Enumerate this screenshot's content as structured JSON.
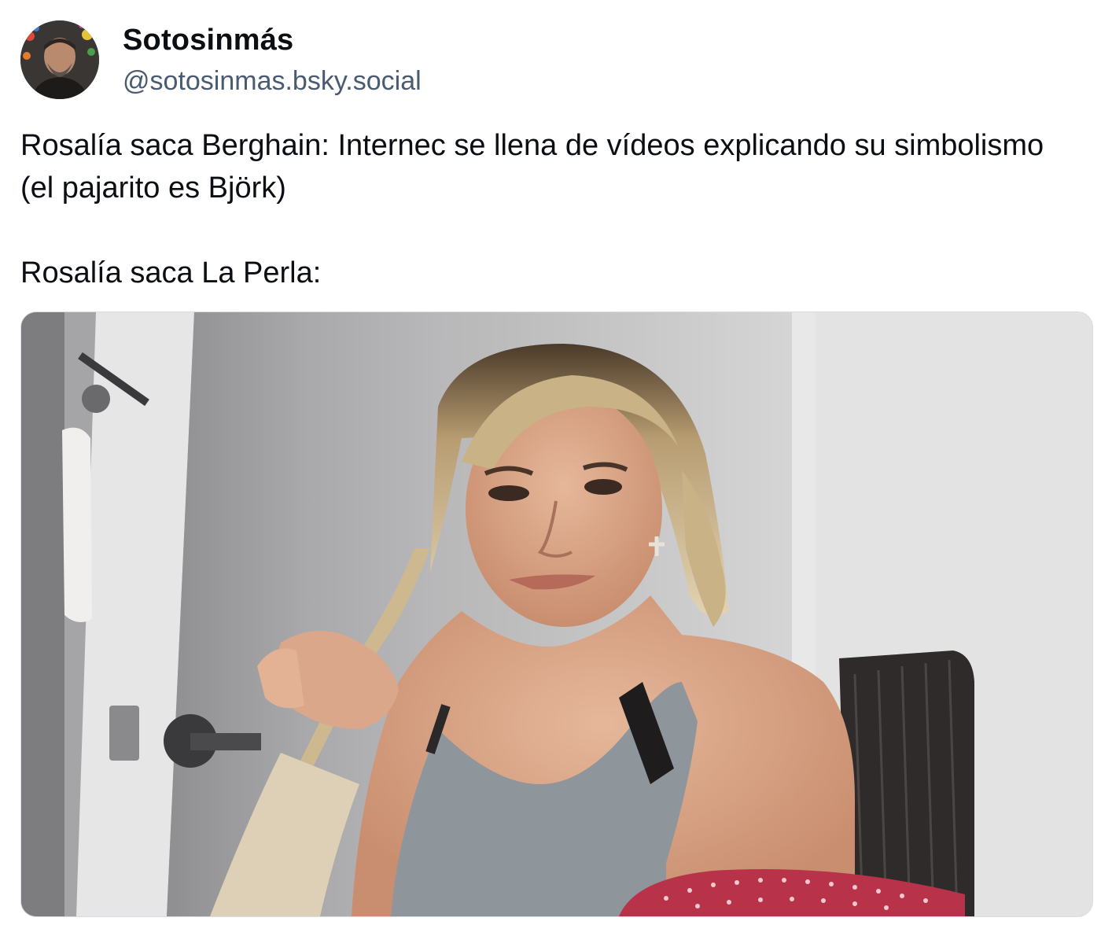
{
  "author": {
    "display_name": "Sotosinmás",
    "handle": "@sotosinmas.bsky.social",
    "avatar_icon": "user-avatar-photo"
  },
  "post": {
    "paragraphs": [
      "Rosalía saca Berghain: Internec se llena de vídeos explicando su simbolismo (el pajarito es Björk)",
      "Rosalía saca La Perla:"
    ]
  },
  "media": {
    "type": "image",
    "description": "meme-photo"
  },
  "colors": {
    "text": "#0b0f14",
    "handle": "#4a5a70",
    "border": "#d8dde3"
  }
}
